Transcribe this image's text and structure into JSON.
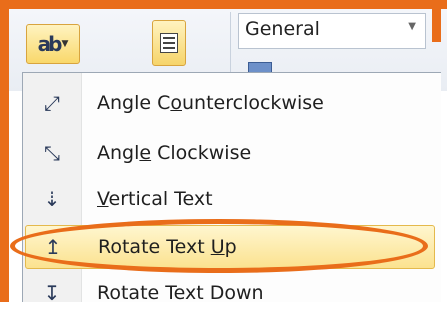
{
  "ribbon": {
    "orientation_glyph": "ab",
    "number_format": "General"
  },
  "menu": {
    "items": [
      {
        "label_pre": "Angle C",
        "label_u": "o",
        "label_post": "unterclockwise",
        "icon": "ab-diagonal-up-icon",
        "glyph": "⤢"
      },
      {
        "label_pre": "Angl",
        "label_u": "e",
        "label_post": " Clockwise",
        "icon": "ab-diagonal-down-icon",
        "glyph": "⤡"
      },
      {
        "label_pre": "",
        "label_u": "V",
        "label_post": "ertical Text",
        "icon": "vertical-text-icon",
        "glyph": "⇣"
      },
      {
        "label_pre": "Rotate Text ",
        "label_u": "U",
        "label_post": "p",
        "icon": "rotate-up-icon",
        "glyph": "↥"
      },
      {
        "label_pre": "Rotate Text Down",
        "label_u": "",
        "label_post": "",
        "icon": "rotate-down-icon",
        "glyph": "↧"
      }
    ]
  },
  "colors": {
    "highlight": "#e96d1a",
    "selected_item": "#fbe28f"
  }
}
